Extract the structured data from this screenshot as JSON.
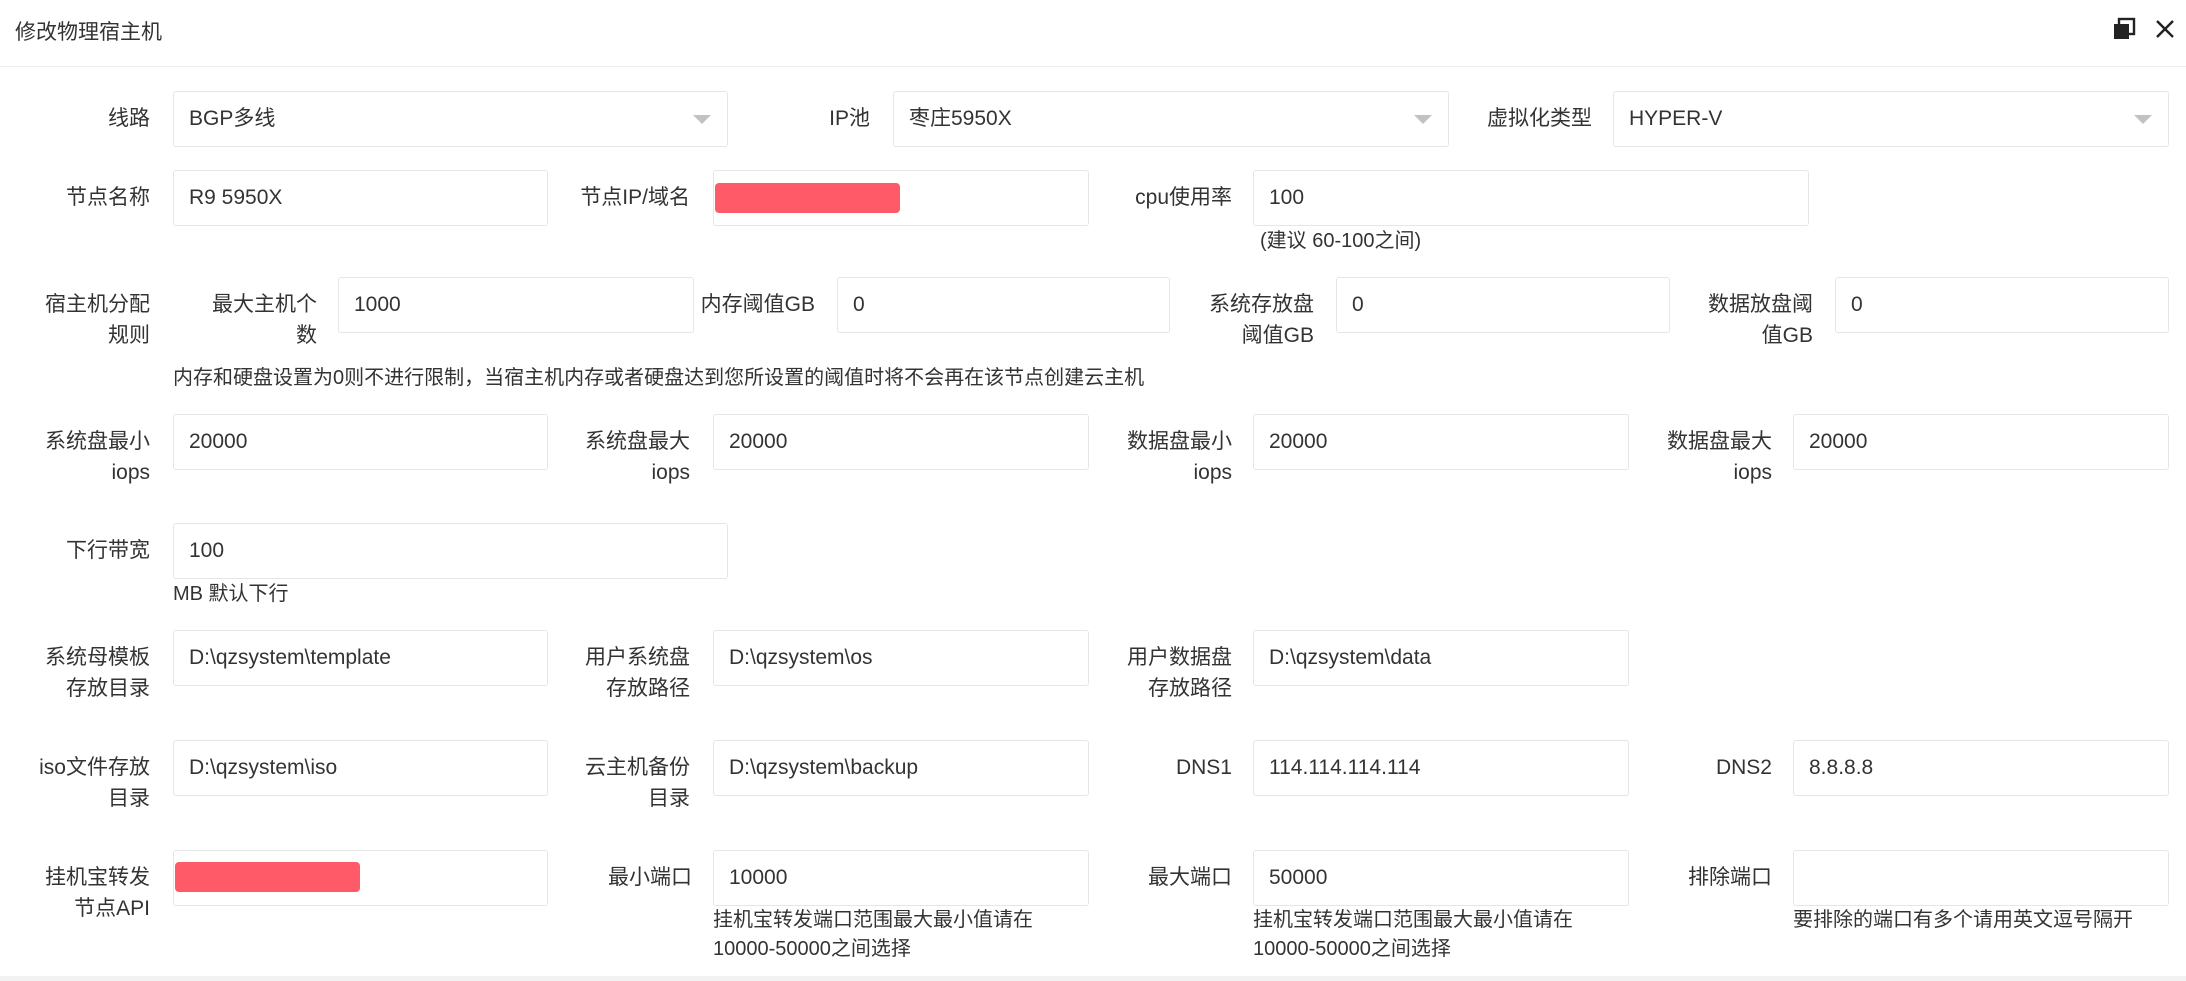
{
  "dialog": {
    "title": "修改物理宿主机",
    "icons": [
      "maximize-icon",
      "close-icon"
    ]
  },
  "row1": {
    "line_label": "线路",
    "line_value": "BGP多线",
    "ippool_label": "IP池",
    "ippool_value": "枣庄5950X",
    "virt_label": "虚拟化类型",
    "virt_value": "HYPER-V"
  },
  "row2": {
    "node_name_label": "节点名称",
    "node_name_value": "R9 5950X",
    "node_ip_label": "节点IP/域名",
    "cpu_label": "cpu使用率",
    "cpu_value": "100",
    "cpu_hint": "(建议 60-100之间)"
  },
  "row3": {
    "rule_label_1": "宿主机分配",
    "rule_label_2": "规则",
    "max_hosts_label_1": "最大主机个",
    "max_hosts_label_2": "数",
    "max_hosts_value": "1000",
    "mem_label": "内存阈值GB",
    "mem_value": "0",
    "sysdisk_label_1": "系统存放盘",
    "sysdisk_label_2": "阈值GB",
    "sysdisk_value": "0",
    "datadisk_label_1": "数据放盘阈",
    "datadisk_label_2": "值GB",
    "datadisk_value": "0",
    "hint": "内存和硬盘设置为0则不进行限制，当宿主机内存或者硬盘达到您所设置的阈值时将不会再在该节点创建云主机"
  },
  "row4": {
    "sys_min_label_1": "系统盘最小",
    "sys_min_label_2": "iops",
    "sys_min_value": "20000",
    "sys_max_label_1": "系统盘最大",
    "sys_max_label_2": "iops",
    "sys_max_value": "20000",
    "data_min_label_1": "数据盘最小",
    "data_min_label_2": "iops",
    "data_min_value": "20000",
    "data_max_label_1": "数据盘最大",
    "data_max_label_2": "iops",
    "data_max_value": "20000"
  },
  "row5": {
    "bw_label": "下行带宽",
    "bw_value": "100",
    "bw_hint": "MB 默认下行"
  },
  "row6": {
    "tpl_label_1": "系统母模板",
    "tpl_label_2": "存放目录",
    "tpl_value": "D:\\qzsystem\\template",
    "os_label_1": "用户系统盘",
    "os_label_2": "存放路径",
    "os_value": "D:\\qzsystem\\os",
    "data_label_1": "用户数据盘",
    "data_label_2": "存放路径",
    "data_value": "D:\\qzsystem\\data"
  },
  "row7": {
    "iso_label_1": "iso文件存放",
    "iso_label_2": "目录",
    "iso_value": "D:\\qzsystem\\iso",
    "backup_label_1": "云主机备份",
    "backup_label_2": "目录",
    "backup_value": "D:\\qzsystem\\backup",
    "dns1_label": "DNS1",
    "dns1_value": "114.114.114.114",
    "dns2_label": "DNS2",
    "dns2_value": "8.8.8.8"
  },
  "row8": {
    "api_label_1": "挂机宝转发",
    "api_label_2": "节点API",
    "min_port_label": "最小端口",
    "min_port_value": "10000",
    "min_port_hint_1": "挂机宝转发端口范围最大最小值请在",
    "min_port_hint_2": "10000-50000之间选择",
    "max_port_label": "最大端口",
    "max_port_value": "50000",
    "max_port_hint_1": "挂机宝转发端口范围最大最小值请在",
    "max_port_hint_2": "10000-50000之间选择",
    "excl_label": "排除端口",
    "excl_value": "",
    "excl_hint": "要排除的端口有多个请用英文逗号隔开"
  },
  "colors": {
    "redaction": "#ff5a68",
    "border": "#e6e6e6",
    "text": "#333333"
  }
}
